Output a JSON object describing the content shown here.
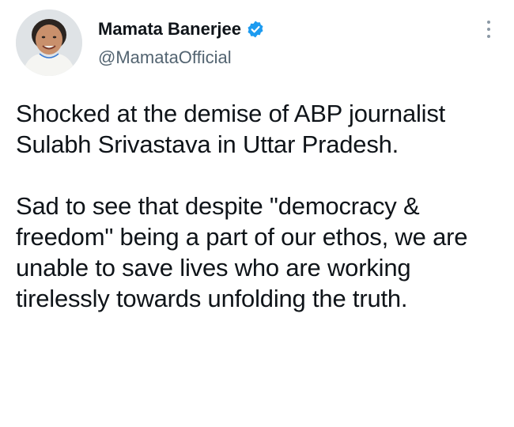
{
  "tweet": {
    "author": {
      "name": "Mamata Banerjee",
      "handle": "@MamataOfficial",
      "verified": true,
      "verified_color": "#1d9bf0"
    },
    "paragraphs": [
      "Shocked at the demise of ABP journalist Sulabh Srivastava in Uttar Pradesh.",
      "Sad to see that despite \"democracy & freedom\" being a part of our ethos, we are unable to save lives who are working tirelessly towards unfolding the truth."
    ],
    "more_icon": "vertical-ellipsis-icon"
  }
}
